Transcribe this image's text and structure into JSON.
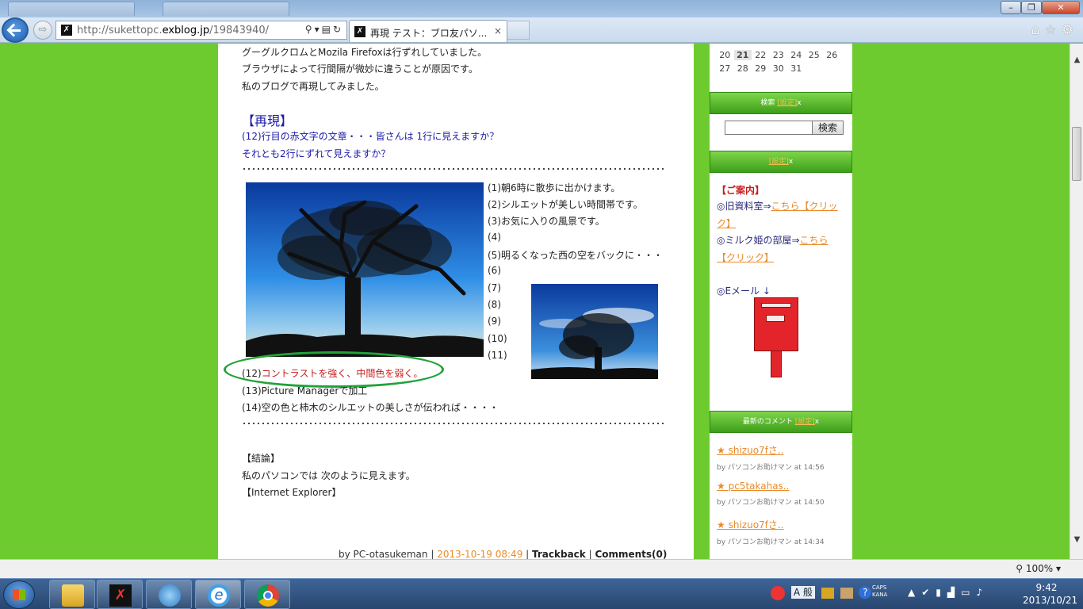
{
  "browser": {
    "url_host": "http://sukettopc.",
    "url_domain": "exblog.jp",
    "url_path": "/19843940/",
    "tab_title": "再現 テスト：ブロ友パソ...",
    "tab_close": "×",
    "favicon_glyph": "✗",
    "zoom": "100%"
  },
  "article": {
    "intro": [
      "グーグルクロムとMozila Firefoxは行ずれしていました。",
      "ブラウザによって行間隔が微妙に違うことが原因です。",
      "私のブログで再現してみました。"
    ],
    "heading": "【再現】",
    "question1": "(12)行目の赤文字の文章・・・皆さんは 1行に見えますか？",
    "question2": "それとも2行にずれて見えますか？",
    "lines_right": [
      "(1)朝6時に散歩に出かけます。",
      "(2)シルエットが美しい時間帯です。",
      "(3)お気に入りの風景です。",
      "(4)",
      "(5)明るくなった西の空をバックに・・・",
      "(6)",
      "(7)",
      "(8)",
      "(9)",
      "(10)",
      "(11)"
    ],
    "line12_prefix": "(12)",
    "line12_red": "コントラストを強く、中間色を弱く。",
    "line13": "(13)Picture Managerで加工",
    "line14": "(14)空の色と柿木のシルエットの美しさが伝われば・・・・",
    "conclusion_title": "【結論】",
    "conclusion_text": "私のパソコンでは 次のように見えます。",
    "conclusion_ie": "【Internet Explorer】",
    "footer_by": "by PC-otasukeman | ",
    "footer_date": "2013-10-19 08:49",
    "footer_sep1": " | ",
    "footer_trackback": "Trackback",
    "footer_sep2": " | ",
    "footer_comments": "Comments(0)"
  },
  "sidebar": {
    "calendar_row1": [
      "20",
      "21",
      "22",
      "23",
      "24",
      "25",
      "26"
    ],
    "calendar_row2": [
      "27",
      "28",
      "29",
      "30",
      "31"
    ],
    "search_title": "検索",
    "settings": "[設定]",
    "close": "x",
    "search_button": "検索",
    "info_heading": "【ご案内】",
    "info1_text": "◎旧資料室⇒",
    "info1_link_a": "こちら【クリッ",
    "info1_link_b": "ク】",
    "info2_text": "◎ミルク姫の部屋⇒",
    "info2_link_a": "こちら",
    "info2_link_b": "【クリック】",
    "email": "◎Eメール ↓",
    "comments_title": "最新のコメント",
    "comments": [
      {
        "title": "shizuo7fさ..",
        "by": "by パソコンお助けマン at 14:56"
      },
      {
        "title": "pc5takahas..",
        "by": "by パソコンお助けマン at 14:50"
      },
      {
        "title": "shizuo7fさ..",
        "by": "by パソコンお助けマン at 14:34"
      }
    ],
    "star": "★"
  },
  "taskbar": {
    "ime": "A 般",
    "caps": "CAPS",
    "kana": "KANA",
    "time": "9:42",
    "date": "2013/10/21"
  },
  "colors": {
    "page_bg": "#6dcb2f",
    "link_orange": "#e98b2a",
    "text_red": "#c81d1d",
    "heading_blue": "#1a1aa8",
    "ellipse_green": "#22a23a"
  }
}
